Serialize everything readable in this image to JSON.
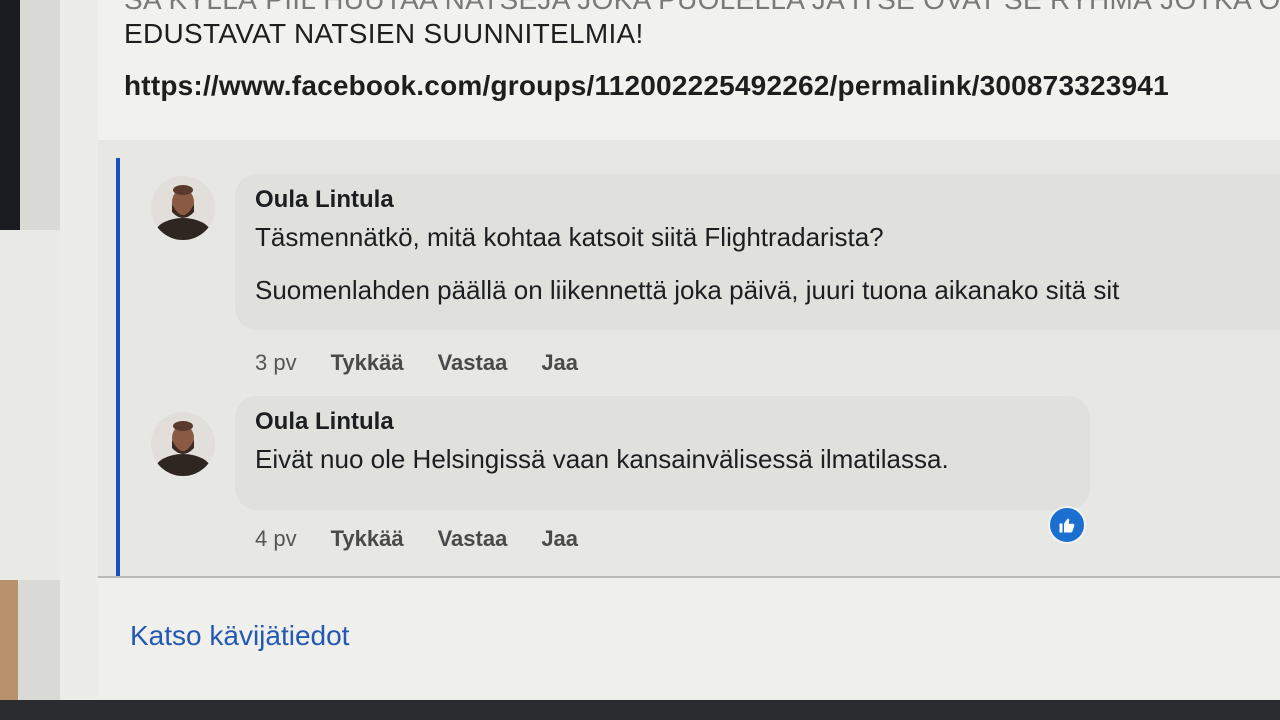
{
  "post": {
    "text_top": "SA KYLLÄ PIIL HUUTAA NATSEJA JOKA PUOLELLA JA ITSE OVAT SE RYHMÄ JOTKA O",
    "text": "EDUSTAVAT NATSIEN SUUNNITELMIA!",
    "link": "https://www.facebook.com/groups/112002225492262/permalink/300873323941"
  },
  "comments": [
    {
      "author": "Oula Lintula",
      "lines": [
        "Täsmennätkö, mitä kohtaa katsoit siitä Flightradarista?",
        "Suomenlahden päällä on liikennettä joka päivä, juuri tuona aikanako sitä sit"
      ],
      "time": "3 pv",
      "like_label": "Tykkää",
      "reply_label": "Vastaa",
      "share_label": "Jaa"
    },
    {
      "author": "Oula Lintula",
      "lines": [
        "Eivät nuo ole Helsingissä vaan kansainvälisessä ilmatilassa."
      ],
      "time": "4 pv",
      "like_label": "Tykkää",
      "reply_label": "Vastaa",
      "share_label": "Jaa",
      "reaction_icon": "thumbs-up-icon"
    }
  ],
  "footer": {
    "link": "Katso kävijätiedot"
  },
  "colors": {
    "thread_line": "#1d4fbf",
    "link": "#2358b3",
    "reaction": "#1a6fd0"
  }
}
